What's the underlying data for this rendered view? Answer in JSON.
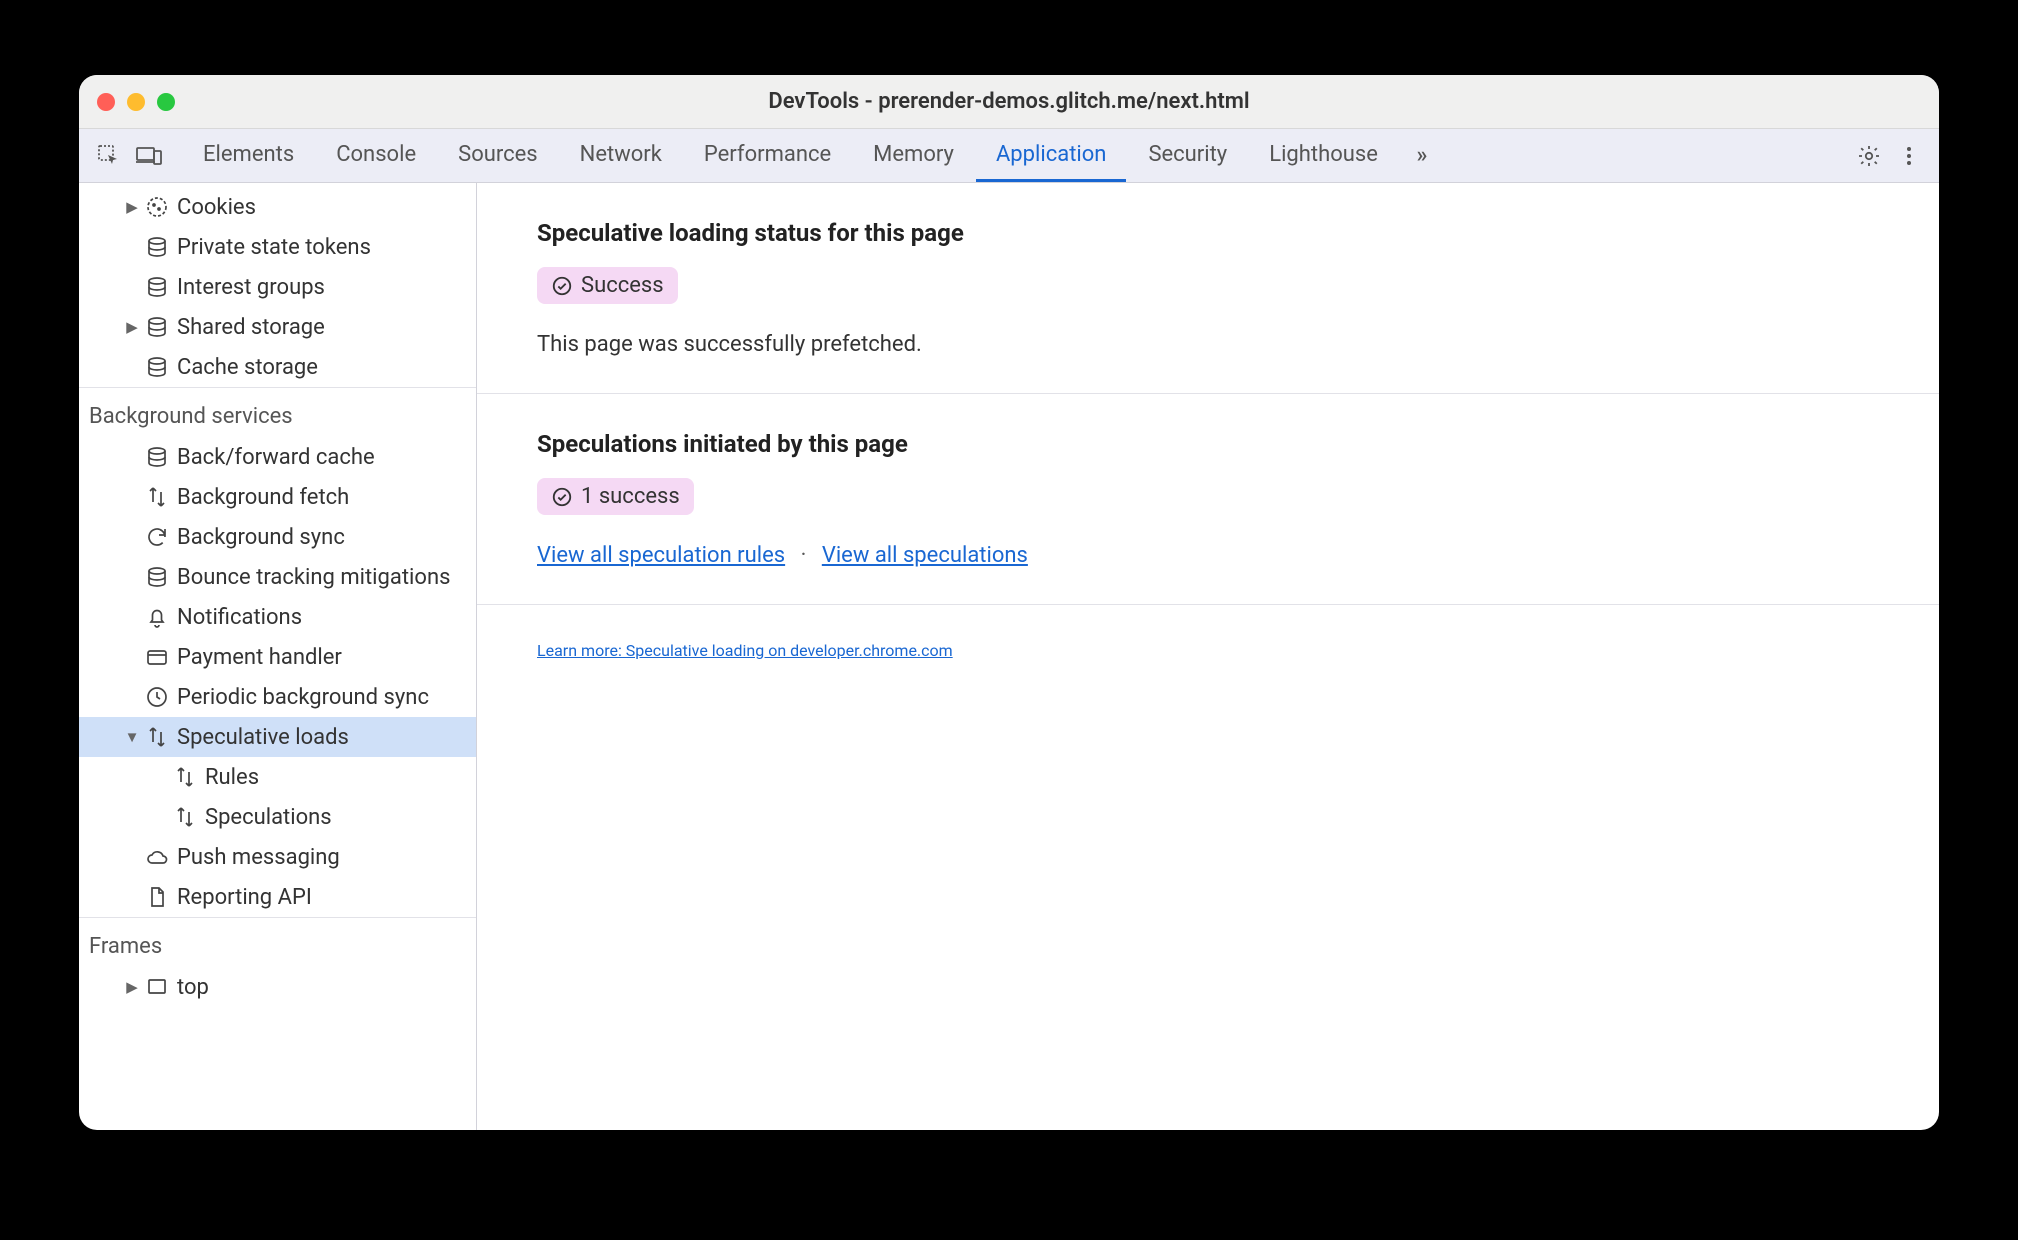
{
  "window": {
    "title": "DevTools - prerender-demos.glitch.me/next.html"
  },
  "tabs": {
    "items": [
      "Elements",
      "Console",
      "Sources",
      "Network",
      "Performance",
      "Memory",
      "Application",
      "Security",
      "Lighthouse"
    ],
    "active": "Application"
  },
  "sidebar": {
    "storage_items": [
      {
        "label": "Cookies",
        "icon": "cookie",
        "arrow": true,
        "depth": 2
      },
      {
        "label": "Private state tokens",
        "icon": "db",
        "arrow": false,
        "depth": 2
      },
      {
        "label": "Interest groups",
        "icon": "db",
        "arrow": false,
        "depth": 2
      },
      {
        "label": "Shared storage",
        "icon": "db",
        "arrow": true,
        "depth": 2
      },
      {
        "label": "Cache storage",
        "icon": "db",
        "arrow": false,
        "depth": 2
      }
    ],
    "bg_header": "Background services",
    "bg_items": [
      {
        "label": "Back/forward cache",
        "icon": "db",
        "arrow": false,
        "depth": 2
      },
      {
        "label": "Background fetch",
        "icon": "updown",
        "arrow": false,
        "depth": 2
      },
      {
        "label": "Background sync",
        "icon": "sync",
        "arrow": false,
        "depth": 2
      },
      {
        "label": "Bounce tracking mitigations",
        "icon": "db",
        "arrow": false,
        "depth": 2
      },
      {
        "label": "Notifications",
        "icon": "bell",
        "arrow": false,
        "depth": 2
      },
      {
        "label": "Payment handler",
        "icon": "card",
        "arrow": false,
        "depth": 2
      },
      {
        "label": "Periodic background sync",
        "icon": "clock",
        "arrow": false,
        "depth": 2
      },
      {
        "label": "Speculative loads",
        "icon": "updown",
        "arrow": "down",
        "depth": 2,
        "selected": true
      },
      {
        "label": "Rules",
        "icon": "updown",
        "arrow": false,
        "depth": 3
      },
      {
        "label": "Speculations",
        "icon": "updown",
        "arrow": false,
        "depth": 3
      },
      {
        "label": "Push messaging",
        "icon": "cloud",
        "arrow": false,
        "depth": 2
      },
      {
        "label": "Reporting API",
        "icon": "doc",
        "arrow": false,
        "depth": 2
      }
    ],
    "frames_header": "Frames",
    "frames_items": [
      {
        "label": "top",
        "icon": "frame",
        "arrow": true,
        "depth": 2
      }
    ]
  },
  "main": {
    "block1": {
      "heading": "Speculative loading status for this page",
      "badge": "Success",
      "desc": "This page was successfully prefetched."
    },
    "block2": {
      "heading": "Speculations initiated by this page",
      "badge": "1 success",
      "link1": "View all speculation rules",
      "link2": "View all speculations"
    },
    "block3": {
      "link": "Learn more: Speculative loading on developer.chrome.com"
    }
  }
}
